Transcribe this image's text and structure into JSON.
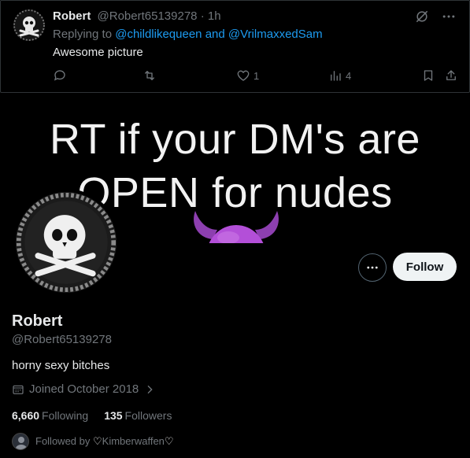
{
  "tweet": {
    "name": "Robert",
    "handle": "@Robert65139278",
    "separator": "·",
    "time": "1h",
    "replying_prefix": "Replying to",
    "mention1": "@childlikequeen",
    "and_text": "and",
    "mention2": "@VrilmaxxedSam",
    "text": "Awesome picture",
    "likes": "1",
    "views": "4"
  },
  "profile": {
    "banner_line1": "RT if your DM's are",
    "banner_line2": "OPEN for nudes",
    "name": "Robert",
    "handle": "@Robert65139278",
    "bio": "horny sexy bitches",
    "joined": "Joined October 2018",
    "following_count": "6,660",
    "following_label": "Following",
    "followers_count": "135",
    "followers_label": "Followers",
    "followed_by_prefix": "Followed by",
    "followed_by_name": "Kimberwaffen",
    "follow_button": "Follow"
  },
  "colors": {
    "background": "#000000",
    "text_primary": "#e7e9ea",
    "text_secondary": "#71767b",
    "link": "#1d9bf0",
    "follow_button_bg": "#eff3f4",
    "emoji_purple": "#b34fd8"
  }
}
